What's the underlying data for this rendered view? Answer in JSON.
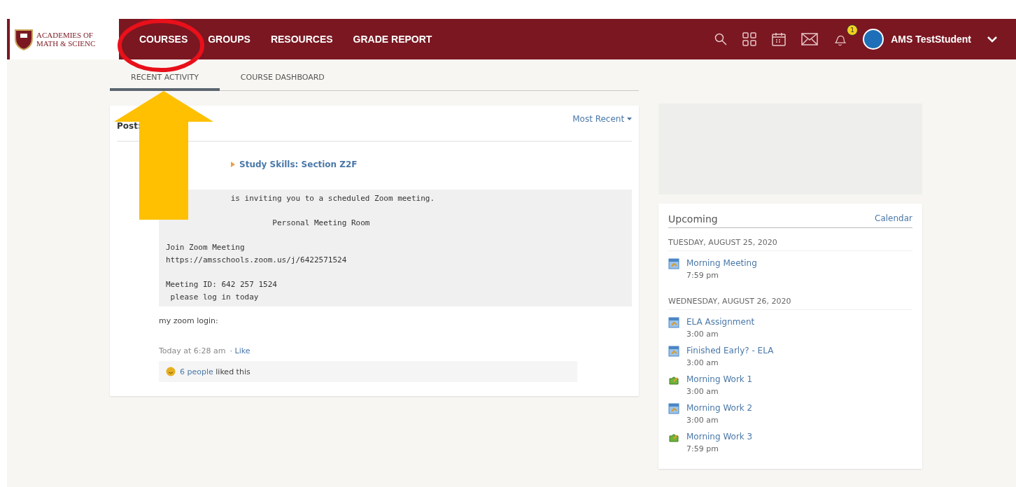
{
  "brand": {
    "line_1": "ACADEMIES OF",
    "line_2": "MATH & SCIENC"
  },
  "nav": [
    {
      "label": "COURSES"
    },
    {
      "label": "GROUPS"
    },
    {
      "label": "RESOURCES"
    },
    {
      "label": "GRADE REPORT"
    }
  ],
  "header_right": {
    "notification_count": "1",
    "user_name": "AMS TestStudent"
  },
  "tabs": [
    {
      "label": "RECENT ACTIVITY",
      "selected": true
    },
    {
      "label": "COURSE DASHBOARD",
      "selected": false
    }
  ],
  "post": {
    "label": "Post:",
    "sort": "Most Recent",
    "course": "Study Skills: Section Z2F",
    "body_blocks": [
      [
        "              is inviting you to a scheduled Zoom meeting."
      ],
      [
        "                       Personal Meeting Room"
      ],
      [
        "Join Zoom Meeting",
        "https://amsschools.zoom.us/j/6422571524"
      ],
      [
        "Meeting ID: 642 257 1524",
        " please log in today"
      ]
    ],
    "comment": "my zoom login:",
    "timestamp": "Today at 6:28 am",
    "like_action": "· Like",
    "likes": {
      "people": "6 people",
      "text": " liked this"
    }
  },
  "upcoming": {
    "title": "Upcoming",
    "calendar_link": "Calendar",
    "days": [
      {
        "date": "TUESDAY, AUGUST 25, 2020",
        "events": [
          {
            "kind": "event",
            "title": "Morning Meeting",
            "time": "7:59 pm"
          }
        ]
      },
      {
        "date": "WEDNESDAY, AUGUST 26, 2020",
        "events": [
          {
            "kind": "event",
            "title": "ELA Assignment",
            "time": "3:00 am"
          },
          {
            "kind": "event",
            "title": "Finished Early? - ELA",
            "time": "3:00 am"
          },
          {
            "kind": "assignment",
            "title": "Morning Work 1",
            "time": "3:00 am"
          },
          {
            "kind": "event",
            "title": "Morning Work 2",
            "time": "3:00 am"
          },
          {
            "kind": "assignment",
            "title": "Morning Work 3",
            "time": "7:59 pm"
          }
        ]
      }
    ]
  }
}
